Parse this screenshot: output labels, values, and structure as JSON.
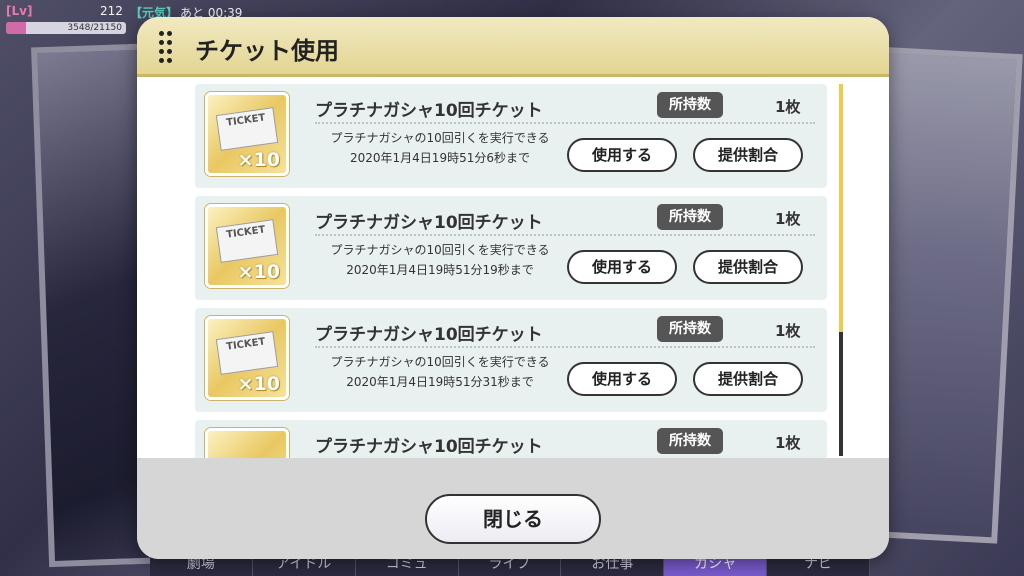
{
  "hud": {
    "lv_label": "[Lv]",
    "level": "212",
    "genki_label": "【元気】",
    "remain_text": "あと 00:39",
    "exp_text": "3548/21150",
    "exp_progress": 0.17
  },
  "dialog": {
    "title": "チケット使用",
    "close_label": "閉じる"
  },
  "tickets": [
    {
      "name": "プラチナガシャ10回チケット",
      "count_label": "所持数",
      "count": "1枚",
      "desc_line1": "プラチナガシャの10回引くを実行できる",
      "desc_line2": "2020年1月4日19時51分6秒まで",
      "use_label": "使用する",
      "rates_label": "提供割合",
      "icon_text": "TICKET",
      "icon_multiplier": "×10"
    },
    {
      "name": "プラチナガシャ10回チケット",
      "count_label": "所持数",
      "count": "1枚",
      "desc_line1": "プラチナガシャの10回引くを実行できる",
      "desc_line2": "2020年1月4日19時51分19秒まで",
      "use_label": "使用する",
      "rates_label": "提供割合",
      "icon_text": "TICKET",
      "icon_multiplier": "×10"
    },
    {
      "name": "プラチナガシャ10回チケット",
      "count_label": "所持数",
      "count": "1枚",
      "desc_line1": "プラチナガシャの10回引くを実行できる",
      "desc_line2": "2020年1月4日19時51分31秒まで",
      "use_label": "使用する",
      "rates_label": "提供割合",
      "icon_text": "TICKET",
      "icon_multiplier": "×10"
    },
    {
      "name": "プラチナガシャ10回チケット",
      "count_label": "所持数",
      "count": "1枚"
    }
  ],
  "bottom_nav": [
    "劇場",
    "アイドル",
    "コミュ",
    "ライブ",
    "お仕事",
    "ガシャ",
    "ナビ"
  ],
  "colors": {
    "header_gold": "#e3d592",
    "scroll_thumb": "#f2c94c",
    "row_bg": "#e9f1f0",
    "badge_bg": "#555555"
  }
}
